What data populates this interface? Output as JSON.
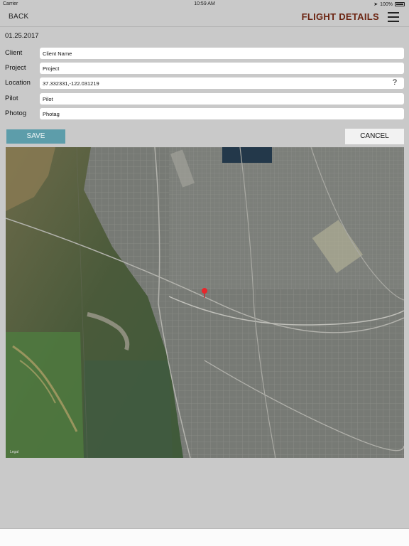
{
  "status_bar": {
    "carrier": "Carrier",
    "time": "10:59 AM",
    "battery": "100%"
  },
  "nav": {
    "back_label": "BACK",
    "title": "FLIGHT DETAILS"
  },
  "date": "01.25.2017",
  "form": {
    "client": {
      "label": "Client",
      "value": "Client Name"
    },
    "project": {
      "label": "Project",
      "value": "Project"
    },
    "location": {
      "label": "Location",
      "value": "37.332331,-122.031219",
      "help": "?"
    },
    "pilot": {
      "label": "Pilot",
      "value": "Pilot"
    },
    "photog": {
      "label": "Photog",
      "value": "Photag"
    }
  },
  "buttons": {
    "save_label": "SAVE",
    "cancel_label": "CANCEL"
  },
  "map": {
    "legal": "Legal",
    "pin_color": "#e8262b"
  },
  "colors": {
    "accent": "#5d9daa",
    "title": "#6b2411",
    "background": "#c9c9c9"
  }
}
